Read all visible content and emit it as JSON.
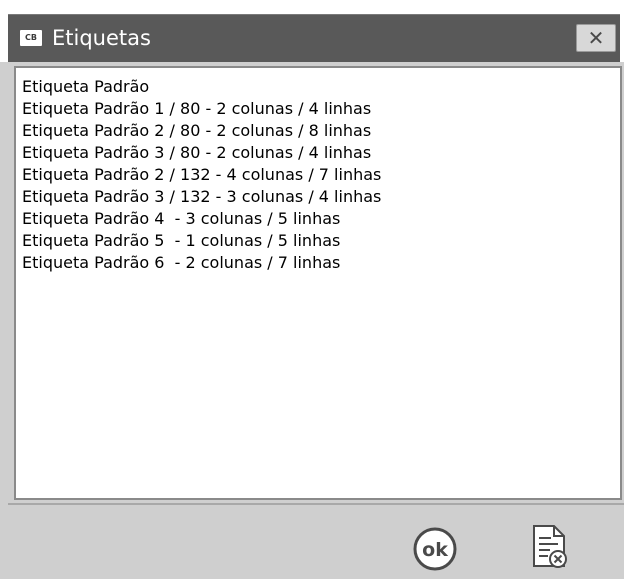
{
  "window": {
    "app_icon": "CB",
    "title": "Etiquetas",
    "close_label": "✕"
  },
  "list": {
    "items": [
      "Etiqueta Padrão",
      "Etiqueta Padrão 1 / 80 - 2 colunas / 4 linhas",
      "Etiqueta Padrão 2 / 80 - 2 colunas / 8 linhas",
      "Etiqueta Padrão 3 / 80 - 2 colunas / 4 linhas",
      "Etiqueta Padrão 2 / 132 - 4 colunas / 7 linhas",
      "Etiqueta Padrão 3 / 132 - 3 colunas / 4 linhas",
      "Etiqueta Padrão 4  - 3 colunas / 5 linhas",
      "Etiqueta Padrão 5  - 1 colunas / 5 linhas",
      "Etiqueta Padrão 6  - 2 colunas / 7 linhas"
    ]
  },
  "footer": {
    "ok_label": "ok",
    "cancel_icon": "document-cancel-icon"
  },
  "colors": {
    "titlebar": "#595959",
    "footer": "#cfcfcf"
  }
}
